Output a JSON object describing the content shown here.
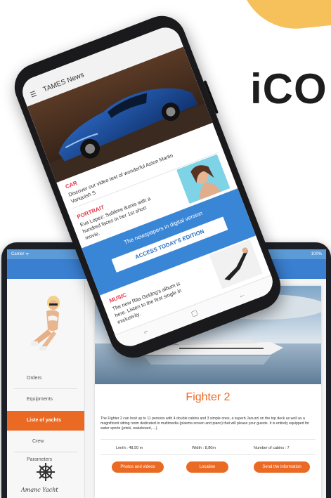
{
  "brand_text": "iCO",
  "colors": {
    "accent": "#ea6a24",
    "phone_blue": "#3a86d6",
    "category_red": "#e33b4c",
    "tablet_bar": "#3a7fd0"
  },
  "phone": {
    "app_title": "TAMES News",
    "menu_icon": "hamburger-icon",
    "articles": [
      {
        "category": "CAR",
        "text_1": "Discover our video test of wonderful Aston Martin",
        "text_2": "Vanquish S"
      },
      {
        "category": "PORTRAIT",
        "text_1": "Eva Lopez: Sublime ikonis with a",
        "text_2": "hundred faces in her 1st short",
        "text_3": "movie."
      },
      {
        "category": "MUSIC",
        "text_1": "The new Rita Goldng's album is",
        "text_2": "here. Listen to the first single in",
        "text_3": "exclusivity."
      }
    ],
    "banner": {
      "text": "The newspapers in digital version",
      "button": "ACCESS TODAY'S EDITION"
    },
    "nav_icons": [
      "recent-apps-icon",
      "home-icon",
      "back-icon"
    ]
  },
  "tablet": {
    "status_left": "Carrier ᯤ",
    "status_right": "100%",
    "nav": [
      "Orders",
      "Equipments",
      "Liste of yachts",
      "Crew",
      "Parameters"
    ],
    "signature": "Amanc Yacht",
    "yacht_name": "Fighter 2",
    "description": "The Fighter 2 can host up to 11 persons with 4 double cabins and 3 simple ones, a superb Jacuzzi on the top deck as well as a magnificent sitting room dedicated to multimedia (plasma screen and piano) that will please your guests. It is entirely equipped for water sports (jetski, wakeboard, ...).",
    "specs": {
      "length": "Lenth : 48,50 m",
      "width": "Width : 8,80m",
      "cabins": "Number of cabins : 7"
    },
    "buttons": [
      "Photos and videos",
      "Location",
      "Send the information"
    ]
  }
}
